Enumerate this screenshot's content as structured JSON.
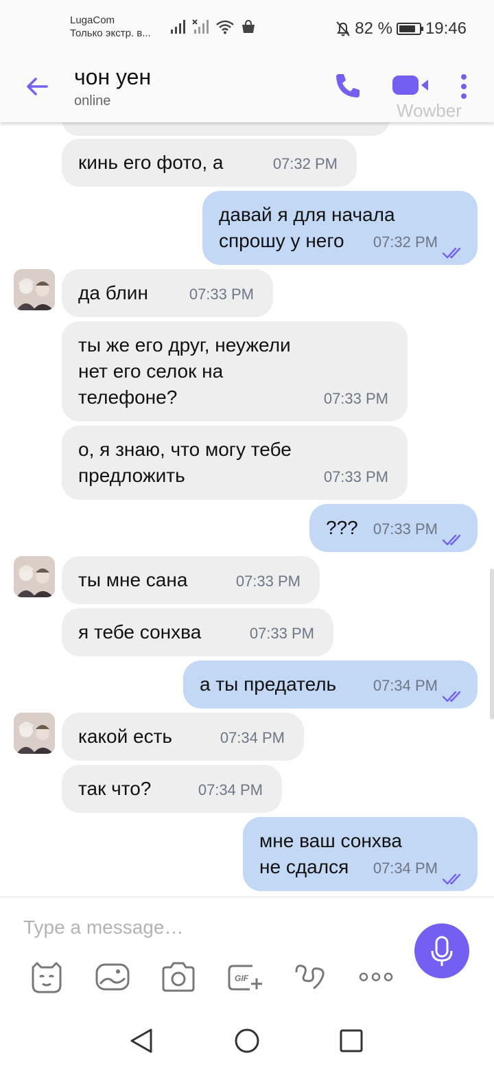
{
  "status_bar": {
    "carrier": "LugaCom",
    "carrier_sub": "Только экстр. в...",
    "battery": "82 %",
    "time": "19:46"
  },
  "header": {
    "name": "чон уен",
    "status": "online",
    "watermark": "Wowber",
    "accent": "#7360f2"
  },
  "messages": [
    {
      "dir": "in",
      "avatar": false,
      "lines": [
        "кинь его фото, а"
      ],
      "time": "07:32 PM"
    },
    {
      "dir": "out",
      "lines": [
        "давай я для начала",
        "спрошу у него"
      ],
      "time": "07:32 PM"
    },
    {
      "dir": "in",
      "avatar": true,
      "lines": [
        "да блин"
      ],
      "time": "07:33 PM"
    },
    {
      "dir": "in",
      "avatar": false,
      "lines": [
        "ты же его друг, неужели",
        "нет его селок на",
        "телефоне?"
      ],
      "time": "07:33 PM"
    },
    {
      "dir": "in",
      "avatar": false,
      "lines": [
        "о, я знаю, что могу тебе",
        "предложить"
      ],
      "time": "07:33 PM"
    },
    {
      "dir": "out",
      "lines": [
        "???"
      ],
      "time": "07:33 PM"
    },
    {
      "dir": "in",
      "avatar": true,
      "lines": [
        "ты мне сана"
      ],
      "time": "07:33 PM"
    },
    {
      "dir": "in",
      "avatar": false,
      "lines": [
        "я тебе сонхва"
      ],
      "time": "07:33 PM"
    },
    {
      "dir": "out",
      "lines": [
        "а ты предатель"
      ],
      "time": "07:34 PM"
    },
    {
      "dir": "in",
      "avatar": true,
      "lines": [
        "какой есть"
      ],
      "time": "07:34 PM"
    },
    {
      "dir": "in",
      "avatar": false,
      "lines": [
        "так что?"
      ],
      "time": "07:34 PM"
    },
    {
      "dir": "out",
      "lines": [
        "мне ваш сонхва",
        "не сдался"
      ],
      "time": "07:34 PM"
    }
  ],
  "composer": {
    "placeholder": "Type a message…",
    "tools": [
      "sticker-icon",
      "gallery-icon",
      "camera-icon",
      "gif-icon",
      "doodle-icon",
      "more-options-icon"
    ]
  }
}
